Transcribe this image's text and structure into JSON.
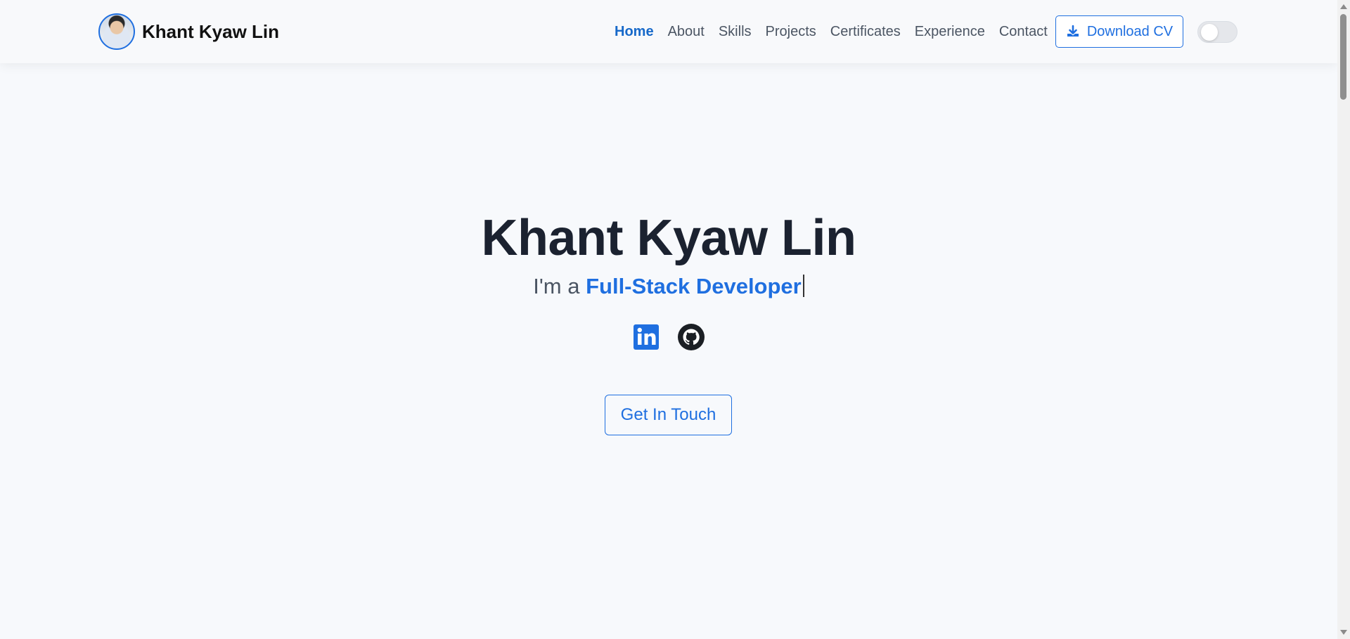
{
  "brand": {
    "name": "Khant Kyaw Lin"
  },
  "nav": {
    "items": [
      {
        "label": "Home",
        "active": true
      },
      {
        "label": "About"
      },
      {
        "label": "Skills"
      },
      {
        "label": "Projects"
      },
      {
        "label": "Certificates"
      },
      {
        "label": "Experience"
      },
      {
        "label": "Contact"
      }
    ],
    "cv_label": "Download CV",
    "theme_toggle": "off"
  },
  "hero": {
    "title": "Khant Kyaw Lin",
    "tagline_prefix": "I'm a ",
    "tagline_role": "Full-Stack Developer",
    "socials": [
      "linkedin-icon",
      "github-icon"
    ],
    "cta_label": "Get In Touch"
  },
  "colors": {
    "accent": "#1f6fe0",
    "nav_active": "#1769c9",
    "background": "#f7f9fc",
    "title": "#1b2230"
  }
}
